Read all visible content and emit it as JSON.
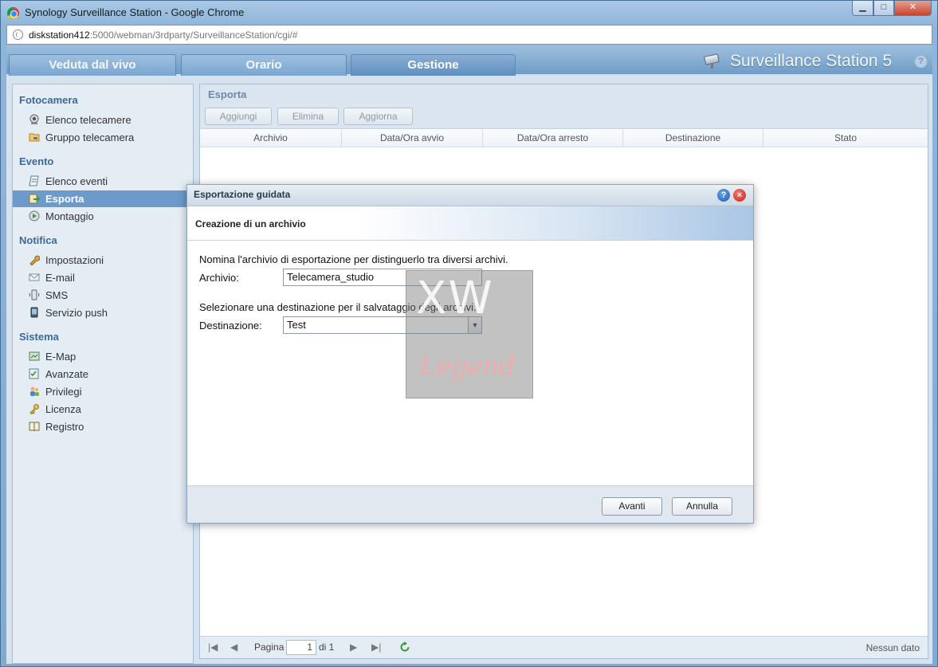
{
  "window": {
    "title": "Synology Surveillance Station - Google Chrome",
    "controls": {
      "minimize": "▁",
      "maximize": "□",
      "close": "✕"
    }
  },
  "address_bar": {
    "host": "diskstation412",
    "path": ":5000/webman/3rdparty/SurveillanceStation/cgi/#"
  },
  "nav": {
    "tabs": [
      {
        "label": "Veduta dal vivo"
      },
      {
        "label": "Orario"
      },
      {
        "label": "Gestione"
      }
    ],
    "active_tab": "Gestione",
    "brand": "Surveillance Station 5",
    "help_icon": "?"
  },
  "sidebar": {
    "groups": [
      {
        "title": "Fotocamera",
        "items": [
          {
            "label": "Elenco telecamere",
            "icon": "webcam-icon"
          },
          {
            "label": "Gruppo telecamera",
            "icon": "folder-camera-icon"
          }
        ]
      },
      {
        "title": "Evento",
        "items": [
          {
            "label": "Elenco eventi",
            "icon": "event-list-icon"
          },
          {
            "label": "Esporta",
            "icon": "export-icon"
          },
          {
            "label": "Montaggio",
            "icon": "montage-icon"
          }
        ]
      },
      {
        "title": "Notifica",
        "items": [
          {
            "label": "Impostazioni",
            "icon": "wrench-icon"
          },
          {
            "label": "E-mail",
            "icon": "mail-icon"
          },
          {
            "label": "SMS",
            "icon": "sms-icon"
          },
          {
            "label": "Servizio push",
            "icon": "phone-icon"
          }
        ]
      },
      {
        "title": "Sistema",
        "items": [
          {
            "label": "E-Map",
            "icon": "map-icon"
          },
          {
            "label": "Avanzate",
            "icon": "advanced-icon"
          },
          {
            "label": "Privilegi",
            "icon": "users-icon"
          },
          {
            "label": "Licenza",
            "icon": "key-icon"
          },
          {
            "label": "Registro",
            "icon": "book-icon"
          }
        ]
      }
    ],
    "selected": "Esporta"
  },
  "panel": {
    "title": "Esporta",
    "toolbar": {
      "add": "Aggiungi",
      "delete": "Elimina",
      "refresh": "Aggiorna"
    },
    "columns": [
      "Archivio",
      "Data/Ora avvio",
      "Data/Ora arresto",
      "Destinazione",
      "Stato"
    ],
    "pager": {
      "page_label": "Pagina",
      "page": "1",
      "of_label": "di 1",
      "status": "Nessun dato"
    }
  },
  "dialog": {
    "title": "Esportazione guidata",
    "subtitle": "Creazione di un archivio",
    "instruction1": "Nomina l'archivio di esportazione per distinguerlo tra diversi archivi.",
    "archive_label": "Archivio:",
    "archive_value": "Telecamera_studio",
    "instruction2": "Selezionare una destinazione per il salvataggio degli archivi.",
    "destination_label": "Destinazione:",
    "destination_value": "Test",
    "buttons": {
      "next": "Avanti",
      "cancel": "Annulla"
    },
    "help_icon": "?",
    "close_icon": "×"
  },
  "watermark": {
    "top": "XW",
    "bottom": "Legend"
  },
  "colors": {
    "accent": "#6c9acb",
    "group_title": "#3c6a98",
    "refresh_green": "#3a9a3a"
  }
}
